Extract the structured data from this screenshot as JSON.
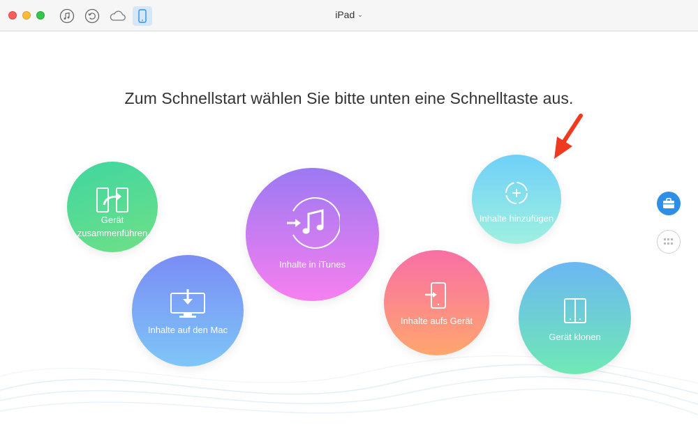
{
  "window": {
    "title": "iPad"
  },
  "toolbar": {
    "icons": [
      "music-note-icon",
      "restore-icon",
      "cloud-icon",
      "phone-icon"
    ]
  },
  "main": {
    "headline": "Zum Schnellstart wählen Sie bitte unten eine Schnelltaste aus.",
    "actions": {
      "merge": {
        "line1": "Gerät",
        "line2": "zusammenführen",
        "icon": "merge-devices-icon"
      },
      "mac": {
        "label": "Inhalte auf den Mac",
        "icon": "monitor-download-icon"
      },
      "itunes": {
        "label": "Inhalte in iTunes",
        "icon": "itunes-icon"
      },
      "device": {
        "label": "Inhalte aufs Gerät",
        "icon": "device-import-icon"
      },
      "add": {
        "label": "Inhalte hinzufügen",
        "icon": "add-circle-icon"
      },
      "clone": {
        "label": "Gerät klonen",
        "icon": "clone-device-icon"
      }
    }
  },
  "sidebar": {
    "buttons": [
      "toolkit-icon",
      "apps-grid-icon"
    ]
  },
  "colors": {
    "accent": "#2e8fe6",
    "annotation_arrow": "#f03a1f"
  }
}
